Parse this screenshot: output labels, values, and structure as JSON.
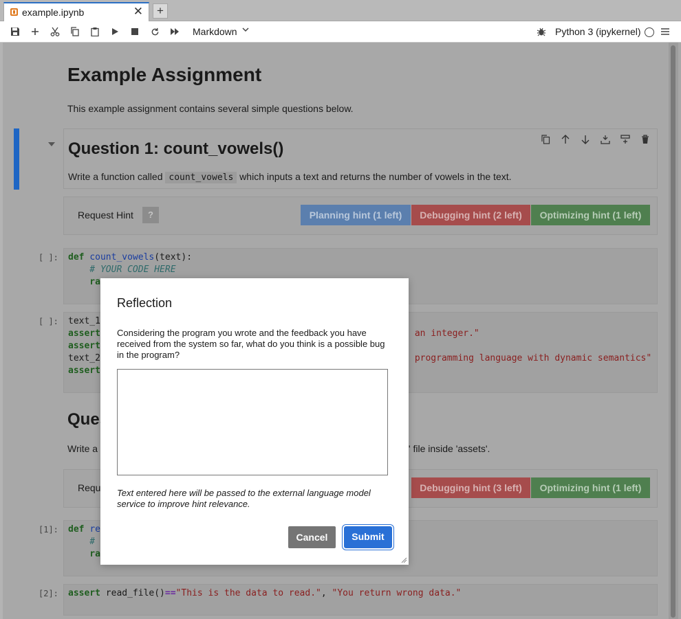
{
  "tab": {
    "filename": "example.ipynb",
    "close_glyph": "✕",
    "add_glyph": "+"
  },
  "toolbar": {
    "cell_type": "Markdown",
    "kernel_name": "Python 3 (ipykernel)",
    "icons": [
      "save-icon",
      "add-cell-icon",
      "cut-icon",
      "copy-icon",
      "paste-icon",
      "run-icon",
      "stop-icon",
      "restart-icon",
      "run-all-icon",
      "bug-icon",
      "kernel-status-icon",
      "menu-icon"
    ]
  },
  "notebook": {
    "title": "Example Assignment",
    "intro": "This example assignment contains several simple questions below.",
    "question1": {
      "title": "Question 1: count_vowels()",
      "desc_before": "Write a function called ",
      "desc_code": "count_vowels",
      "desc_after": " which inputs a text and returns the number of vowels in the text."
    },
    "hint_bar_1": {
      "label": "Request Hint",
      "help": "?",
      "planning": "Planning hint (1 left)",
      "debugging": "Debugging hint (2 left)",
      "optimizing": "Optimizing hint (1 left)"
    },
    "code_cell_1": {
      "prompt": "[ ]:",
      "line1_kw": "def",
      "line1_fn": "count_vowels",
      "line1_rest": "(text):",
      "line2": "    # YOUR CODE HERE",
      "line3": "    ra"
    },
    "code_cell_2": {
      "prompt": "[ ]:",
      "line1": "text_1",
      "line2_kw": "assert",
      "line2_tail": " an integer.\"",
      "line3_kw": "assert",
      "line4": "text_2",
      "line4_tail": " programming language with dynamic semantics\"",
      "line5_kw": "assert"
    },
    "question2": {
      "title_partial": "Ques",
      "desc_left": "Write a",
      "desc_right": "t' file inside 'assets'."
    },
    "hint_bar_2": {
      "label": "Requ",
      "debugging": "Debugging hint (3 left)",
      "optimizing": "Optimizing hint (1 left)"
    },
    "code_cell_3": {
      "prompt": "[1]:",
      "line1_kw": "def",
      "line1_fn": "re",
      "line2": "    #",
      "line3": "    ra"
    },
    "code_cell_4": {
      "prompt": "[2]:",
      "kw": "assert",
      "call": " read_file()",
      "op": "==",
      "str1": "\"This is the data to read.\"",
      "sep": ", ",
      "str2": "\"You return wrong data.\""
    }
  },
  "modal": {
    "title": "Reflection",
    "prompt": "Considering the program you wrote and the feedback you have received from the system so far, what do you think is a possible bug in the program?",
    "textarea_value": "",
    "note": "Text entered here will be passed to the external language model service to improve hint relevance.",
    "cancel": "Cancel",
    "submit": "Submit"
  },
  "colors": {
    "accent": "#1f66c4",
    "planning": "#5b7fae",
    "debugging": "#a64c4c",
    "optimizing": "#4f7f4f",
    "submit": "#2970d6",
    "cancel": "#757575"
  }
}
